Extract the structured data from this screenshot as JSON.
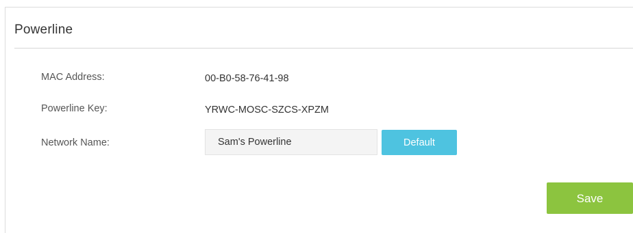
{
  "section": {
    "title": "Powerline"
  },
  "fields": {
    "mac_label": "MAC Address:",
    "mac_value": "00-B0-58-76-41-98",
    "key_label": "Powerline Key:",
    "key_value": "YRWC-MOSC-SZCS-XPZM",
    "network_label": "Network Name:",
    "network_value": "Sam's Powerline"
  },
  "buttons": {
    "default_label": "Default",
    "save_label": "Save"
  },
  "colors": {
    "default_button": "#4ec3e0",
    "save_button": "#8cc43f",
    "input_background": "#f4f4f4"
  }
}
